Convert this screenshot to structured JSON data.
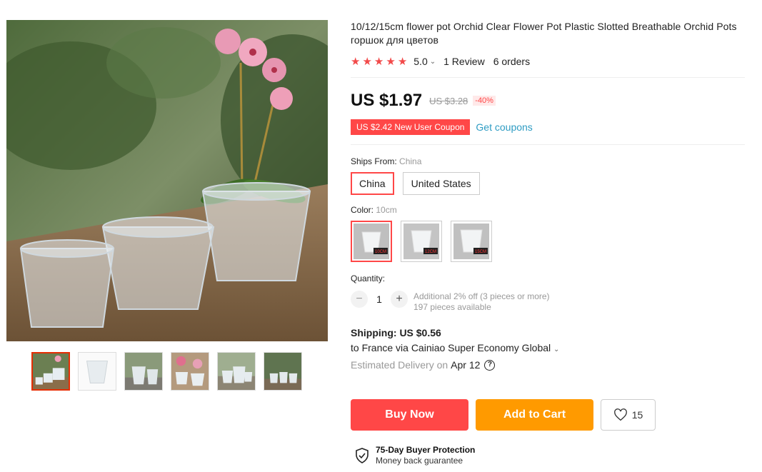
{
  "product": {
    "title": "10/12/15cm flower pot Orchid Clear Flower Pot Plastic Slotted Breathable Orchid Pots горшок для цветов",
    "rating": "5.0",
    "reviews": "1 Review",
    "orders": "6 orders"
  },
  "price": {
    "current": "US $1.97",
    "original": "US $3.28",
    "discount": "-40%"
  },
  "coupon": {
    "label": "US $2.42 New User Coupon",
    "link": "Get coupons"
  },
  "ships_from": {
    "label": "Ships From:",
    "selected": "China",
    "options": [
      "China",
      "United States"
    ]
  },
  "color": {
    "label": "Color:",
    "selected": "10cm",
    "swatches": [
      "10CM",
      "12CM",
      "15CM"
    ]
  },
  "quantity": {
    "label": "Quantity:",
    "value": "1",
    "minus": "−",
    "plus": "+",
    "note_discount": "Additional 2% off (3 pieces or more)",
    "note_available": "197 pieces available"
  },
  "shipping": {
    "label": "Shipping:",
    "cost": "US $0.56",
    "route": "to France via Cainiao Super Economy Global",
    "delivery_label": "Estimated Delivery on",
    "delivery_date": "Apr 12",
    "help": "?"
  },
  "actions": {
    "buy": "Buy Now",
    "cart": "Add to Cart",
    "wishlist_count": "15"
  },
  "protection": {
    "title": "75-Day Buyer Protection",
    "subtitle": "Money back guarantee"
  },
  "icons": {
    "star": "star-icon",
    "heart": "heart-icon",
    "shield": "shield-check-icon",
    "chevron": "chevron-down-icon",
    "help": "question-circle-icon"
  },
  "colors": {
    "accent": "#ff4747",
    "cart": "#ff9a00",
    "link": "#2e9cc3"
  }
}
